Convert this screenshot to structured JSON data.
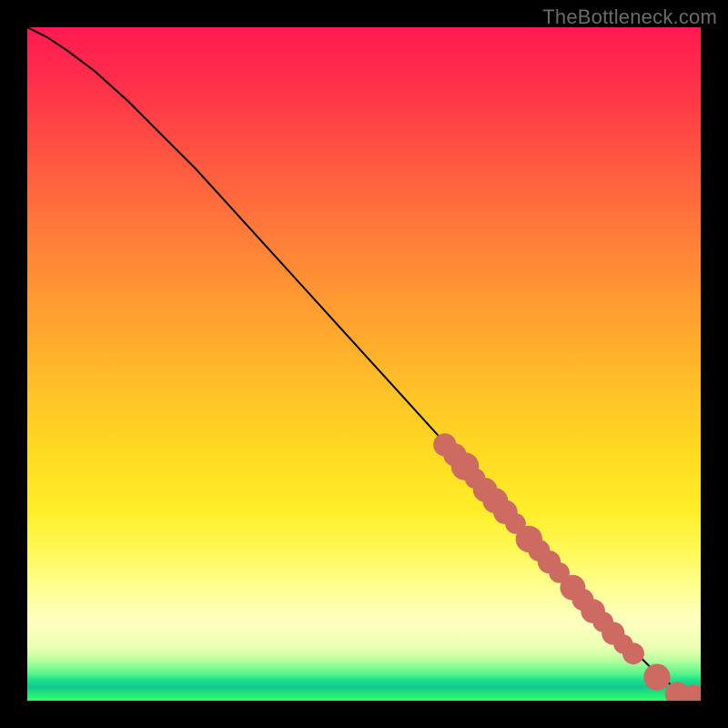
{
  "watermark": "TheBottleneck.com",
  "colors": {
    "marker": "#cd6b62",
    "curve": "#000000",
    "frame": "#000000"
  },
  "chart_data": {
    "type": "line",
    "title": "",
    "xlabel": "",
    "ylabel": "",
    "xlim": [
      0,
      100
    ],
    "ylim": [
      0,
      100
    ],
    "grid": false,
    "legend": false,
    "series": [
      {
        "name": "bottleneck-curve",
        "x": [
          0,
          3,
          6,
          10,
          15,
          20,
          25,
          30,
          35,
          40,
          45,
          50,
          55,
          60,
          65,
          70,
          75,
          80,
          85,
          90,
          93,
          96,
          100
        ],
        "values": [
          100,
          98.5,
          96.5,
          93.5,
          89,
          84,
          79,
          73.5,
          68,
          62.5,
          57,
          51.5,
          46,
          40.5,
          35,
          29.5,
          24,
          18.5,
          13,
          7.5,
          4.5,
          2,
          0.5
        ]
      }
    ],
    "highlight_clusters": [
      {
        "x": 62,
        "y": 38,
        "r": 1.3
      },
      {
        "x": 63.5,
        "y": 36.5,
        "r": 1.3
      },
      {
        "x": 65,
        "y": 34.8,
        "r": 1.7
      },
      {
        "x": 66.5,
        "y": 33,
        "r": 1.1
      },
      {
        "x": 68,
        "y": 31.3,
        "r": 1.4
      },
      {
        "x": 69.5,
        "y": 29.7,
        "r": 1.5
      },
      {
        "x": 71,
        "y": 28,
        "r": 1.4
      },
      {
        "x": 72.5,
        "y": 26.3,
        "r": 1.1
      },
      {
        "x": 74.5,
        "y": 24,
        "r": 1.6
      },
      {
        "x": 76,
        "y": 22.3,
        "r": 1.2
      },
      {
        "x": 77.5,
        "y": 20.6,
        "r": 1.3
      },
      {
        "x": 79,
        "y": 19,
        "r": 1.1
      },
      {
        "x": 81,
        "y": 16.8,
        "r": 1.5
      },
      {
        "x": 82.5,
        "y": 15,
        "r": 1.2
      },
      {
        "x": 84,
        "y": 13.3,
        "r": 1.4
      },
      {
        "x": 85.5,
        "y": 11.7,
        "r": 1.1
      },
      {
        "x": 87,
        "y": 10,
        "r": 1.3
      },
      {
        "x": 88.5,
        "y": 8.4,
        "r": 1.0
      },
      {
        "x": 90,
        "y": 7,
        "r": 1.2
      },
      {
        "x": 93.5,
        "y": 3.5,
        "r": 1.6
      },
      {
        "x": 96.5,
        "y": 1,
        "r": 1.4
      },
      {
        "x": 99,
        "y": 0.7,
        "r": 1.3
      }
    ],
    "flat_tail": {
      "x0": 96.5,
      "x1": 99,
      "y": 0.8
    }
  }
}
